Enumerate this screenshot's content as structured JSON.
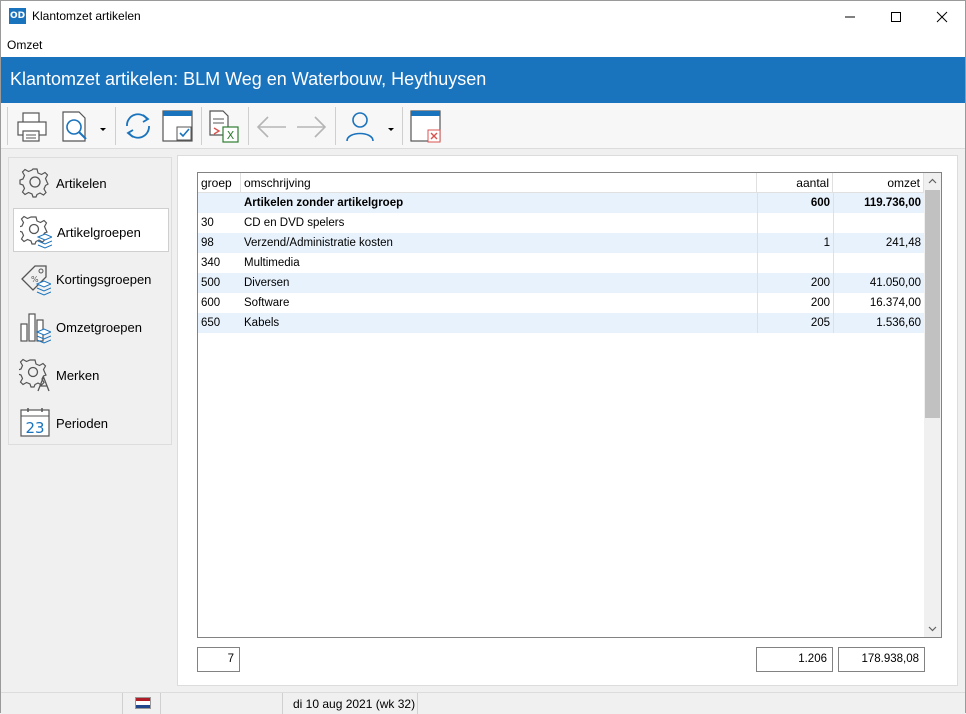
{
  "window": {
    "app_icon_text": "OD",
    "title": "Klantomzet artikelen"
  },
  "menu": {
    "items": [
      {
        "label": "Omzet"
      }
    ]
  },
  "header": {
    "title": "Klantomzet artikelen: BLM Weg en Waterbouw, Heythuysen"
  },
  "toolbar": {
    "buttons": [
      "printer-icon",
      "print-preview-icon",
      "refresh-icon",
      "window-check-icon",
      "export-excel-icon",
      "back-arrow-icon",
      "forward-arrow-icon",
      "user-icon",
      "close-window-icon"
    ]
  },
  "sidebar": {
    "items": [
      {
        "label": "Artikelen",
        "icon": "gear-icon"
      },
      {
        "label": "Artikelgroepen",
        "icon": "gear-layers-icon",
        "active": true
      },
      {
        "label": "Kortingsgroepen",
        "icon": "tag-icon"
      },
      {
        "label": "Omzetgroepen",
        "icon": "bar-chart-icon"
      },
      {
        "label": "Merken",
        "icon": "gear-letter-icon"
      },
      {
        "label": "Perioden",
        "icon": "calendar-icon",
        "calendar_day": "23"
      }
    ]
  },
  "grid": {
    "columns": {
      "groep": "groep",
      "omschrijving": "omschrijving",
      "aantal": "aantal",
      "omzet": "omzet"
    },
    "rows": [
      {
        "groep": "",
        "omschrijving": "Artikelen zonder artikelgroep",
        "aantal": "600",
        "omzet": "119.736,00",
        "bold": true
      },
      {
        "groep": "30",
        "omschrijving": "CD en DVD spelers",
        "aantal": "",
        "omzet": ""
      },
      {
        "groep": "98",
        "omschrijving": "Verzend/Administratie kosten",
        "aantal": "1",
        "omzet": "241,48"
      },
      {
        "groep": "340",
        "omschrijving": "Multimedia",
        "aantal": "",
        "omzet": ""
      },
      {
        "groep": "500",
        "omschrijving": "Diversen",
        "aantal": "200",
        "omzet": "41.050,00"
      },
      {
        "groep": "600",
        "omschrijving": "Software",
        "aantal": "200",
        "omzet": "16.374,00"
      },
      {
        "groep": "650",
        "omschrijving": "Kabels",
        "aantal": "205",
        "omzet": "1.536,60"
      }
    ]
  },
  "totals": {
    "count": "7",
    "aantal": "1.206",
    "omzet": "178.938,08"
  },
  "status": {
    "date": "di 10 aug 2021 (wk 32)"
  },
  "colors": {
    "accent": "#1a73bd",
    "row_alt": "#e8f2fc"
  }
}
